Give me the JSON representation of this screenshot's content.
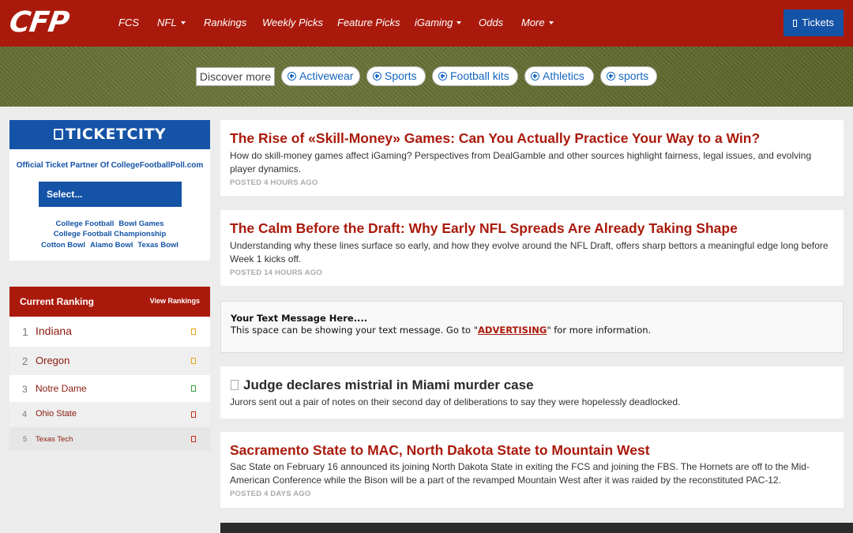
{
  "nav": {
    "logo": "CFP",
    "items": [
      {
        "label": "FCS",
        "dropdown": false
      },
      {
        "label": "NFL",
        "dropdown": true
      },
      {
        "label": "Rankings",
        "dropdown": false
      },
      {
        "label": "Weekly Picks",
        "dropdown": false
      },
      {
        "label": "Feature Picks",
        "dropdown": false
      },
      {
        "label": "iGaming",
        "dropdown": true
      },
      {
        "label": "Odds",
        "dropdown": false
      },
      {
        "label": "More",
        "dropdown": true
      }
    ],
    "tickets_label": "Tickets",
    "bg_color": "#aa1a0c",
    "tickets_color": "#1453a6"
  },
  "discover": {
    "label": "Discover more",
    "chips": [
      "Activewear",
      "Sports",
      "Football kits",
      "Athletics",
      "sports"
    ]
  },
  "ticketcity": {
    "brand": "TICKETCITY",
    "partner_text": "Official Ticket Partner Of CollegeFootballPoll.com",
    "select_label": "Select...",
    "links_row1": [
      "College Football",
      "Bowl Games"
    ],
    "links_row2": [
      "College Football Championship"
    ],
    "links_row3": [
      "Cotton Bowl",
      "Alamo Bowl",
      "Texas Bowl"
    ]
  },
  "ranking": {
    "title": "Current Ranking",
    "view_label": "View Rankings",
    "rows": [
      {
        "rank": "1",
        "team": "Indiana",
        "indicator_color": "#e8a317"
      },
      {
        "rank": "2",
        "team": "Oregon",
        "indicator_color": "#e8a317"
      },
      {
        "rank": "3",
        "team": "Notre Dame",
        "indicator_color": "#3a9a3a"
      },
      {
        "rank": "4",
        "team": "Ohio State",
        "indicator_color": "#cc2a1a"
      },
      {
        "rank": "5",
        "team": "Texas Tech",
        "indicator_color": "#cc2a1a"
      }
    ]
  },
  "articles": [
    {
      "title": "The Rise of «Skill-Money» Games: Can You Actually Practice Your Way to a Win?",
      "desc": "How do skill-money games affect iGaming? Perspectives from DealGamble and other sources highlight fairness, legal issues, and evolving player dynamics.",
      "posted": "POSTED 4 HOURS AGO"
    },
    {
      "title": "The Calm Before the Draft: Why Early NFL Spreads Are Already Taking Shape",
      "desc": "Understanding why these lines surface so early, and how they evolve around the NFL Draft, offers sharp bettors a meaningful edge long before Week 1 kicks off.",
      "posted": "POSTED 14 HOURS AGO"
    }
  ],
  "ad": {
    "title": "Your Text Message Here....",
    "text_before": "This space can be showing your text message. Go to \"",
    "link": "ADVERTISING",
    "text_after": "\" for more information."
  },
  "news": {
    "title": "Judge declares mistrial in Miami murder case",
    "desc": "Jurors sent out a pair of notes on their second day of deliberations to say they were hopelessly deadlocked."
  },
  "article3": {
    "title": "Sacramento State to MAC, North Dakota State to Mountain West",
    "desc": "Sac State on February 16 announced its joining North Dakota State in exiting the FCS and joining the FBS. The Hornets are off to the Mid-American Conference while the Bison will be a part of the revamped Mountain West after it was raided by the reconstituted PAC-12.",
    "posted": "POSTED 4 DAYS AGO"
  }
}
